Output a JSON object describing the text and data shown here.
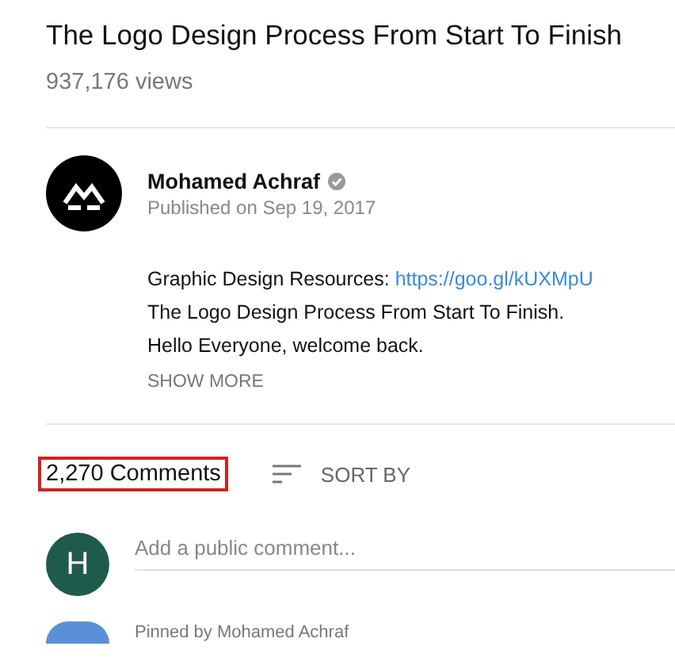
{
  "video": {
    "title": "The Logo Design Process From Start To Finish",
    "views": "937,176 views"
  },
  "channel": {
    "name": "Mohamed Achraf",
    "verified": true,
    "published": "Published on Sep 19, 2017"
  },
  "description": {
    "lines": [
      {
        "text": "Graphic Design Resources: ",
        "link": "https://goo.gl/kUXMpU"
      },
      {
        "text": "The Logo Design Process From Start To Finish."
      },
      {
        "text": "Hello Everyone, welcome back."
      }
    ],
    "show_more": "SHOW MORE"
  },
  "comments": {
    "count": "2,270 Comments",
    "highlighted": true,
    "sort_label": "SORT BY",
    "user_initial": "H",
    "placeholder": "Add a public comment...",
    "pinned": "Pinned by Mohamed Achraf"
  }
}
